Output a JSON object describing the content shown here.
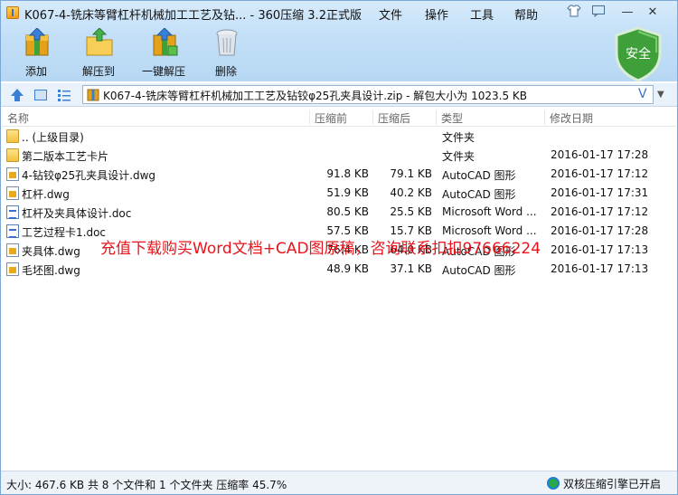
{
  "window": {
    "title": "K067-4-铣床等臂杠杆机械加工工艺及钻... - 360压缩 3.2正式版"
  },
  "menu": {
    "file": "文件",
    "operate": "操作",
    "tools": "工具",
    "help": "帮助"
  },
  "window_buttons": {
    "minimize": "—",
    "close": "✕"
  },
  "toolbar": {
    "add": "添加",
    "extract_to": "解压到",
    "one_click_extract": "一键解压",
    "delete": "删除"
  },
  "security_badge": "安全",
  "address": {
    "path": "K067-4-铣床等臂杠杆机械加工工艺及钻铰φ25孔夹具设计.zip - 解包大小为 1023.5 KB"
  },
  "columns": {
    "name": "名称",
    "size": "压缩前",
    "compressed": "压缩后",
    "type": "类型",
    "modified": "修改日期"
  },
  "files": [
    {
      "icon": "folder",
      "name": ".. (上级目录)",
      "size": "",
      "compressed": "",
      "type": "文件夹",
      "modified": ""
    },
    {
      "icon": "folder",
      "name": "第二版本工艺卡片",
      "size": "",
      "compressed": "",
      "type": "文件夹",
      "modified": "2016-01-17 17:28"
    },
    {
      "icon": "dwg",
      "name": "4-钻铰φ25孔夹具设计.dwg",
      "size": "91.8 KB",
      "compressed": "79.1 KB",
      "type": "AutoCAD 图形",
      "modified": "2016-01-17 17:12"
    },
    {
      "icon": "dwg",
      "name": "杠杆.dwg",
      "size": "51.9 KB",
      "compressed": "40.2 KB",
      "type": "AutoCAD 图形",
      "modified": "2016-01-17 17:31"
    },
    {
      "icon": "doc",
      "name": "杠杆及夹具体设计.doc",
      "size": "80.5 KB",
      "compressed": "25.5 KB",
      "type": "Microsoft Word ...",
      "modified": "2016-01-17 17:12"
    },
    {
      "icon": "doc",
      "name": "工艺过程卡1.doc",
      "size": "57.5 KB",
      "compressed": "15.7 KB",
      "type": "Microsoft Word ...",
      "modified": "2016-01-17 17:28"
    },
    {
      "icon": "dwg",
      "name": "夹具体.dwg",
      "size": "76.4 KB",
      "compressed": "64.0 KB",
      "type": "AutoCAD 图形",
      "modified": "2016-01-17 17:13"
    },
    {
      "icon": "dwg",
      "name": "毛坯图.dwg",
      "size": "48.9 KB",
      "compressed": "37.1 KB",
      "type": "AutoCAD 图形",
      "modified": "2016-01-17 17:13"
    }
  ],
  "watermark": "充值下载购买Word文档+CAD图原稿，咨询联系扣扣97666224",
  "status": {
    "summary": "大小: 467.6 KB 共 8 个文件和 1 个文件夹 压缩率 45.7%",
    "engine": "双核压缩引擎已开启"
  },
  "colors": {
    "accent": "#3a6fd1",
    "watermark": "#e8131b",
    "shield": "#3fa03a"
  }
}
